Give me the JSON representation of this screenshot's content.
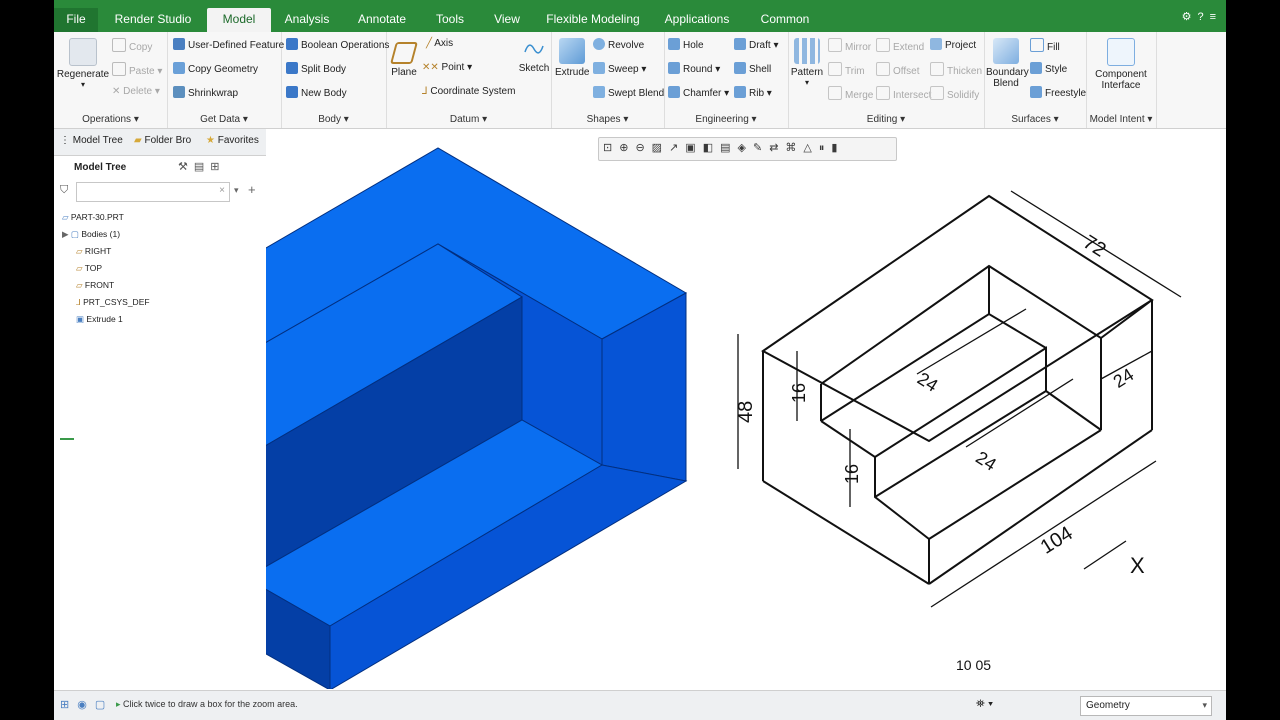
{
  "tabs": [
    "File",
    "Render Studio",
    "Model",
    "Analysis",
    "Annotate",
    "Tools",
    "View",
    "Flexible Modeling",
    "Applications",
    "Common"
  ],
  "ribbon": {
    "operations": {
      "regenerate": "Regenerate",
      "copy": "Copy",
      "paste": "Paste",
      "delete": "Delete",
      "label": "Operations"
    },
    "getdata": {
      "udf": "User-Defined Feature",
      "copygeom": "Copy Geometry",
      "shrinkwrap": "Shrinkwrap",
      "label": "Get Data"
    },
    "body": {
      "boolean": "Boolean Operations",
      "split": "Split Body",
      "newbody": "New Body",
      "label": "Body"
    },
    "datum": {
      "plane": "Plane",
      "axis": "Axis",
      "point": "Point",
      "csys": "Coordinate System",
      "sketch": "Sketch",
      "label": "Datum"
    },
    "shapes": {
      "extrude": "Extrude",
      "revolve": "Revolve",
      "sweep": "Sweep",
      "sweptblend": "Swept Blend",
      "label": "Shapes"
    },
    "engineering": {
      "hole": "Hole",
      "round": "Round",
      "chamfer": "Chamfer",
      "draft": "Draft",
      "shell": "Shell",
      "rib": "Rib",
      "label": "Engineering"
    },
    "editing": {
      "pattern": "Pattern",
      "mirror": "Mirror",
      "trim": "Trim",
      "merge": "Merge",
      "extend": "Extend",
      "offset": "Offset",
      "intersect": "Intersect",
      "project": "Project",
      "thicken": "Thicken",
      "solidify": "Solidify",
      "label": "Editing"
    },
    "surfaces": {
      "boundary1": "Boundary",
      "boundary2": "Blend",
      "fill": "Fill",
      "style": "Style",
      "freestyle": "Freestyle",
      "label": "Surfaces"
    },
    "modelintent": {
      "comp1": "Component",
      "comp2": "Interface",
      "label": "Model Intent"
    }
  },
  "panel": {
    "tabs": [
      "Model Tree",
      "Folder Bro",
      "Favorites"
    ],
    "header": "Model Tree",
    "items": [
      "PART-30.PRT",
      "Bodies (1)",
      "RIGHT",
      "TOP",
      "FRONT",
      "PRT_CSYS_DEF",
      "Extrude 1"
    ]
  },
  "drawing": {
    "dims": {
      "d72": "72",
      "d48": "48",
      "d16a": "16",
      "d16b": "16",
      "d24a": "24",
      "d24b": "24",
      "d24c": "24",
      "d104": "104",
      "x": "X",
      "partial": "10 05"
    }
  },
  "status": {
    "message": "Click twice to draw a box for the zoom area.",
    "filter": "Geometry"
  },
  "colors": {
    "tabbar": "#2a8a3a",
    "model_top": "#0a6ef0",
    "model_mid": "#0654d6",
    "model_dark": "#043fa6"
  }
}
